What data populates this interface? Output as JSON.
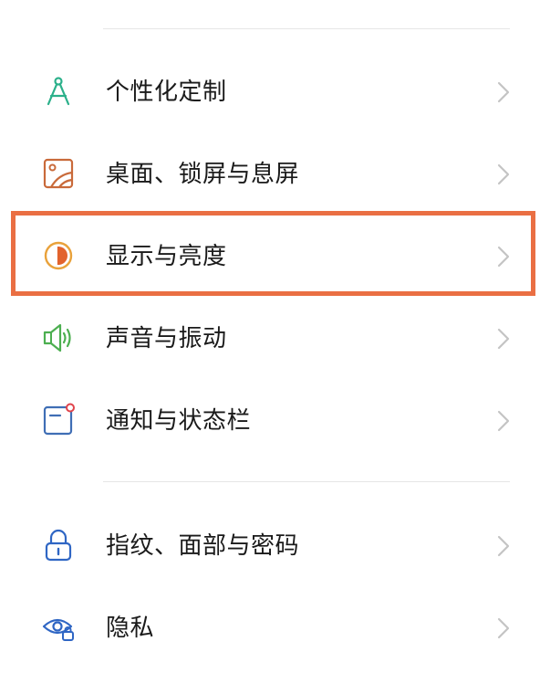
{
  "settings": {
    "items": [
      {
        "label": "个性化定制",
        "icon": "compass-icon",
        "color": "#2bb08a"
      },
      {
        "label": "桌面、锁屏与息屏",
        "icon": "wallpaper-icon",
        "color": "#c96a3a"
      },
      {
        "label": "显示与亮度",
        "icon": "brightness-icon",
        "color": "#e07a2e"
      },
      {
        "label": "声音与振动",
        "icon": "speaker-icon",
        "color": "#4caf50"
      },
      {
        "label": "通知与状态栏",
        "icon": "notification-icon",
        "color": "#3f6eb5"
      },
      {
        "label": "指纹、面部与密码",
        "icon": "lock-icon",
        "color": "#2f66c4"
      },
      {
        "label": "隐私",
        "icon": "privacy-eye-icon",
        "color": "#2f66c4"
      }
    ]
  },
  "highlight": {
    "color": "#ea6f43",
    "target": "显示与亮度"
  }
}
